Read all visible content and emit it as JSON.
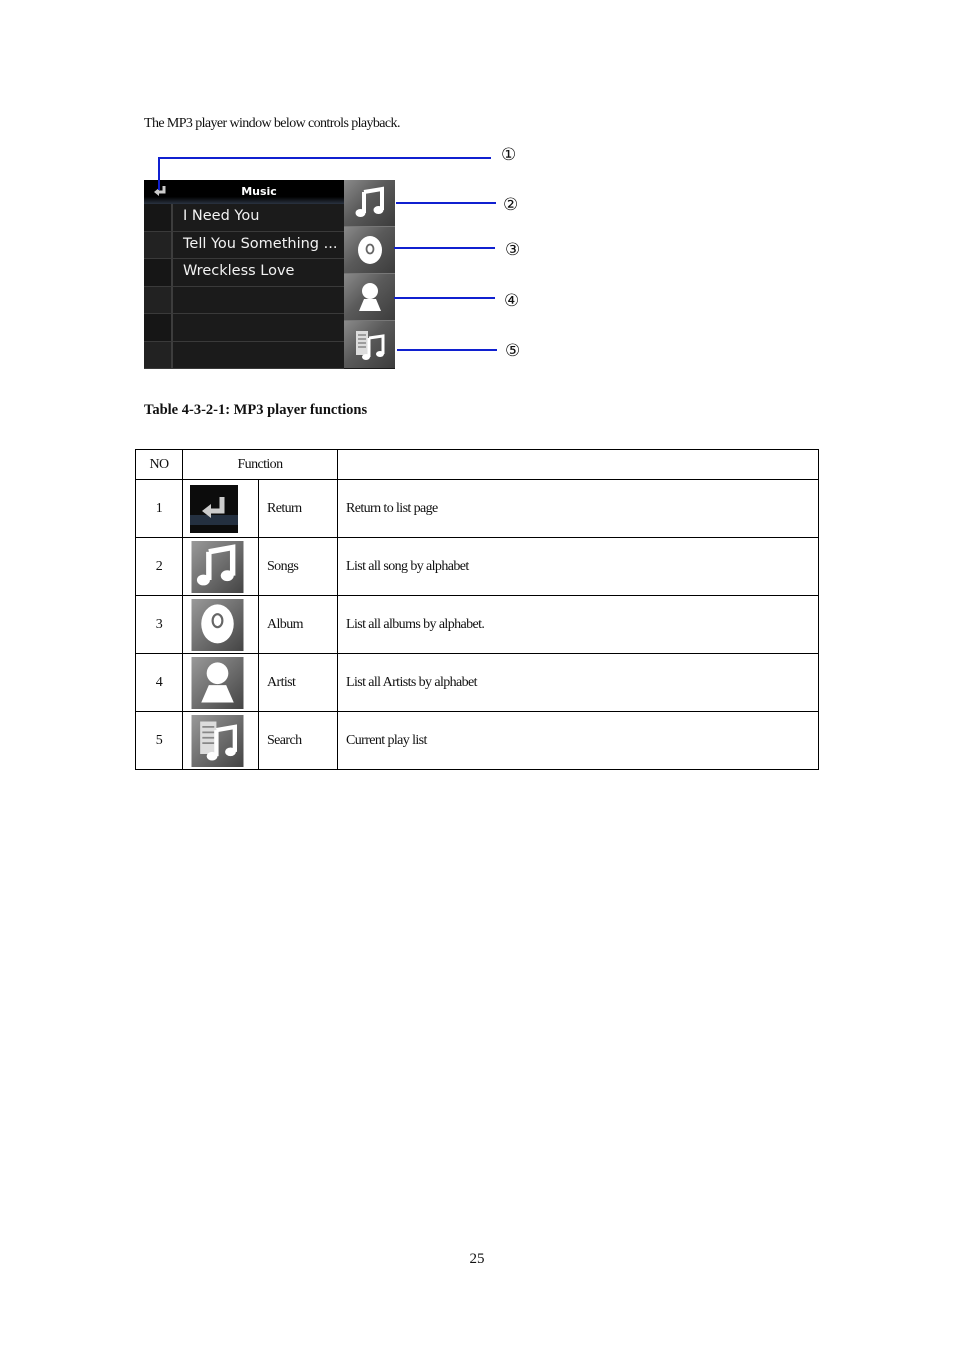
{
  "intro": "The MP3 player window below controls playback.",
  "player": {
    "title": "Music",
    "back_icon": "return-arrow-icon",
    "songs": [
      "I Need You",
      "Tell You Something ...",
      "Wreckless Love",
      "",
      "",
      ""
    ],
    "side_buttons": [
      {
        "icon": "music-note-icon",
        "callout": "②"
      },
      {
        "icon": "album-disc-icon",
        "callout": "③"
      },
      {
        "icon": "artist-person-icon",
        "callout": "④"
      },
      {
        "icon": "playlist-icon",
        "callout": "⑤"
      }
    ],
    "return_callout": "①"
  },
  "callout_color": "#1020d0",
  "caption": "Table 4-3-2-1: MP3 player functions",
  "table": {
    "headers": {
      "no": "NO",
      "function": "Function",
      "description": ""
    },
    "rows": [
      {
        "no": "1",
        "icon": "return-arrow-icon",
        "label": "Return",
        "description": "Return to list page"
      },
      {
        "no": "2",
        "icon": "music-note-icon",
        "label": "Songs",
        "description": "List all song by alphabet"
      },
      {
        "no": "3",
        "icon": "album-disc-icon",
        "label": "Album",
        "description": "List all albums by alphabet."
      },
      {
        "no": "4",
        "icon": "artist-person-icon",
        "label": "Artist",
        "description": "List all Artists by alphabet"
      },
      {
        "no": "5",
        "icon": "playlist-icon",
        "label": "Search",
        "description": "Current play list"
      }
    ]
  },
  "page_number": "25"
}
